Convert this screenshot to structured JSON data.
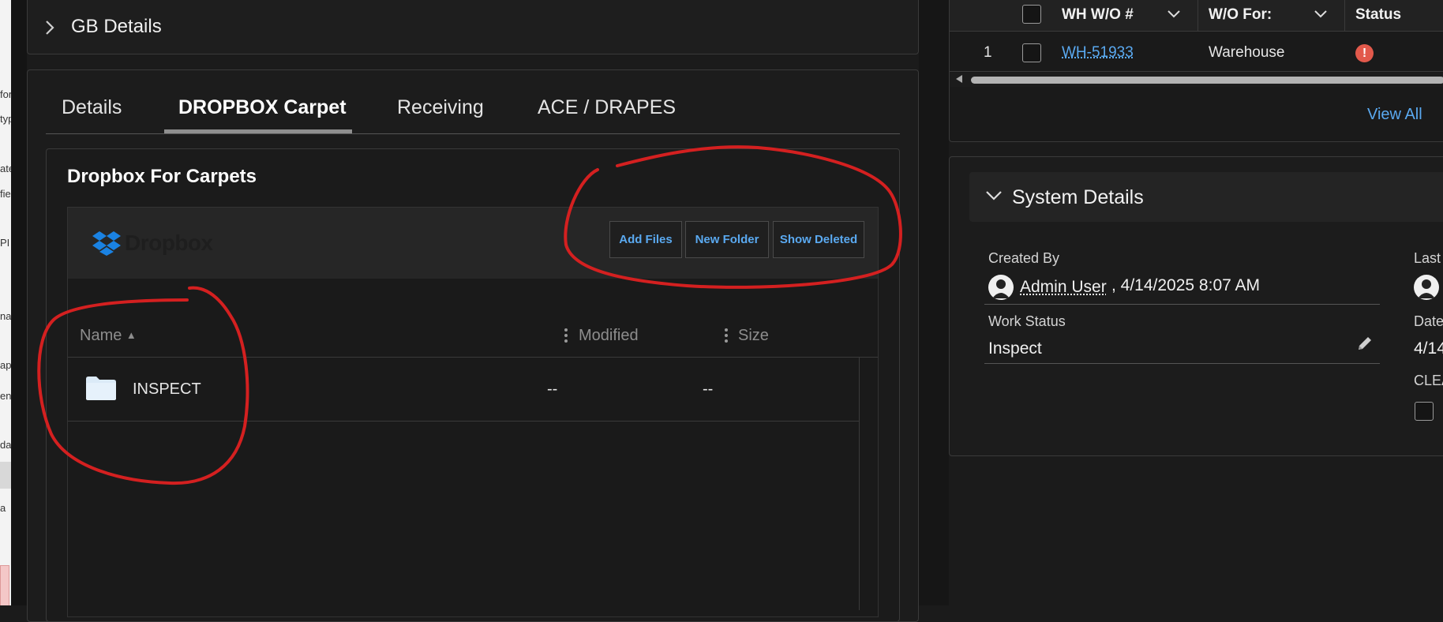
{
  "left_panel": {
    "fragments": [
      "for",
      "typ",
      "ate",
      "fiel",
      "PI",
      "nat",
      "ap",
      "en",
      "da",
      "a"
    ]
  },
  "gb_section": {
    "title": "GB Details"
  },
  "tabs": [
    {
      "label": "Details",
      "active": false
    },
    {
      "label": "DROPBOX Carpet",
      "active": true
    },
    {
      "label": "Receiving",
      "active": false
    },
    {
      "label": "ACE / DRAPES",
      "active": false
    }
  ],
  "dropbox_card": {
    "title": "Dropbox For Carpets",
    "wordmark": "Dropbox",
    "buttons": {
      "add_files": "Add Files",
      "new_folder": "New Folder",
      "show_deleted": "Show Deleted"
    },
    "columns": {
      "name": "Name",
      "modified": "Modified",
      "size": "Size"
    },
    "sort_indicator": "▲",
    "rows": [
      {
        "name": "INSPECT",
        "modified": "--",
        "size": "--",
        "icon": "folder-icon"
      }
    ]
  },
  "work_orders": {
    "columns": {
      "wo_number": "WH W/O #",
      "wo_for": "W/O For:",
      "status": "Status"
    },
    "rows": [
      {
        "index": "1",
        "wo_number": "WH-51933",
        "wo_for": "Warehouse",
        "status_icon": "!"
      }
    ],
    "view_all": "View All"
  },
  "system_details": {
    "title": "System Details",
    "created_by_label": "Created By",
    "created_by_user": "Admin User",
    "created_by_date": ", 4/14/2025 8:07 AM",
    "work_status_label": "Work Status",
    "work_status_value": "Inspect",
    "last_label": "Last",
    "date_label": "Date",
    "date_value": "4/14",
    "clear_label": "CLEA"
  },
  "colors": {
    "link": "#5aa9f0",
    "background": "#1b1b1b",
    "annotation": "#d42020",
    "dropbox_blue": "#1a82e2",
    "error": "#e2594b"
  }
}
